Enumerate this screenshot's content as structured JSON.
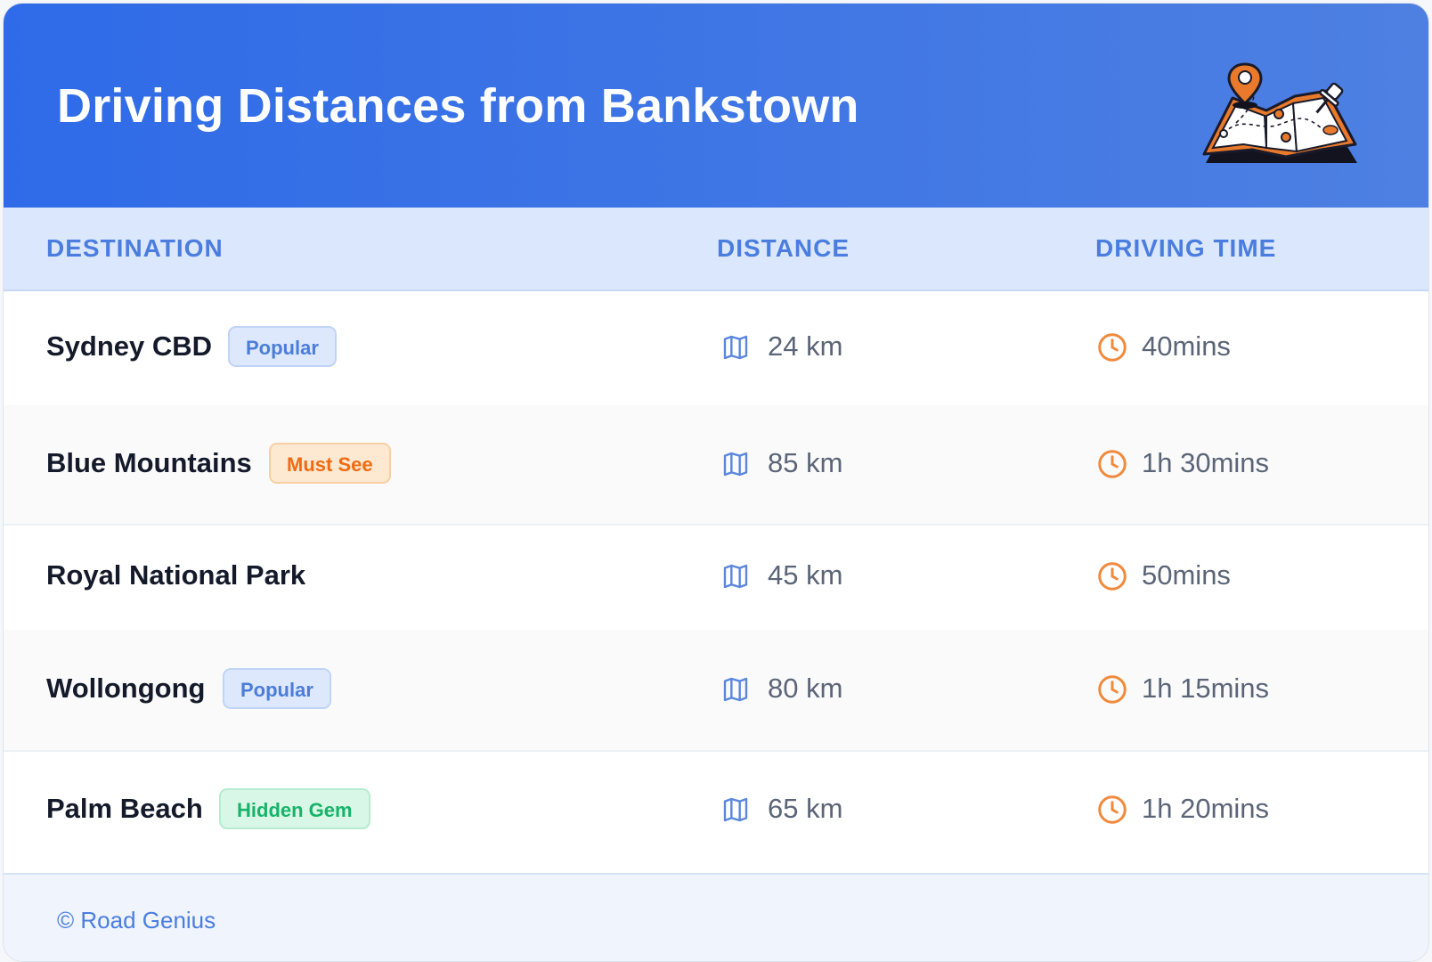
{
  "header": {
    "title": "Driving Distances from Bankstown",
    "illustration": "map-with-pins-icon"
  },
  "table": {
    "columns": [
      "DESTINATION",
      "DISTANCE",
      "DRIVING TIME"
    ],
    "rows": [
      {
        "destination": "Sydney CBD",
        "badge": "Popular",
        "badge_type": "popular",
        "distance": "24 km",
        "time": "40mins"
      },
      {
        "destination": "Blue Mountains",
        "badge": "Must See",
        "badge_type": "must-see",
        "distance": "85 km",
        "time": "1h 30mins"
      },
      {
        "destination": "Royal National Park",
        "badge": null,
        "badge_type": null,
        "distance": "45 km",
        "time": "50mins"
      },
      {
        "destination": "Wollongong",
        "badge": "Popular",
        "badge_type": "popular",
        "distance": "80 km",
        "time": "1h 15mins"
      },
      {
        "destination": "Palm Beach",
        "badge": "Hidden Gem",
        "badge_type": "hidden-gem",
        "distance": "65 km",
        "time": "1h 20mins"
      }
    ],
    "distance_icon": "map-icon",
    "time_icon": "clock-icon"
  },
  "footer": {
    "copyright": "© Road Genius"
  },
  "colors": {
    "header_gradient_start": "#2f6be8",
    "header_gradient_end": "#4e80e2",
    "accent_blue": "#4a7ddf",
    "accent_orange": "#f08a3c",
    "accent_green": "#19b26a"
  }
}
